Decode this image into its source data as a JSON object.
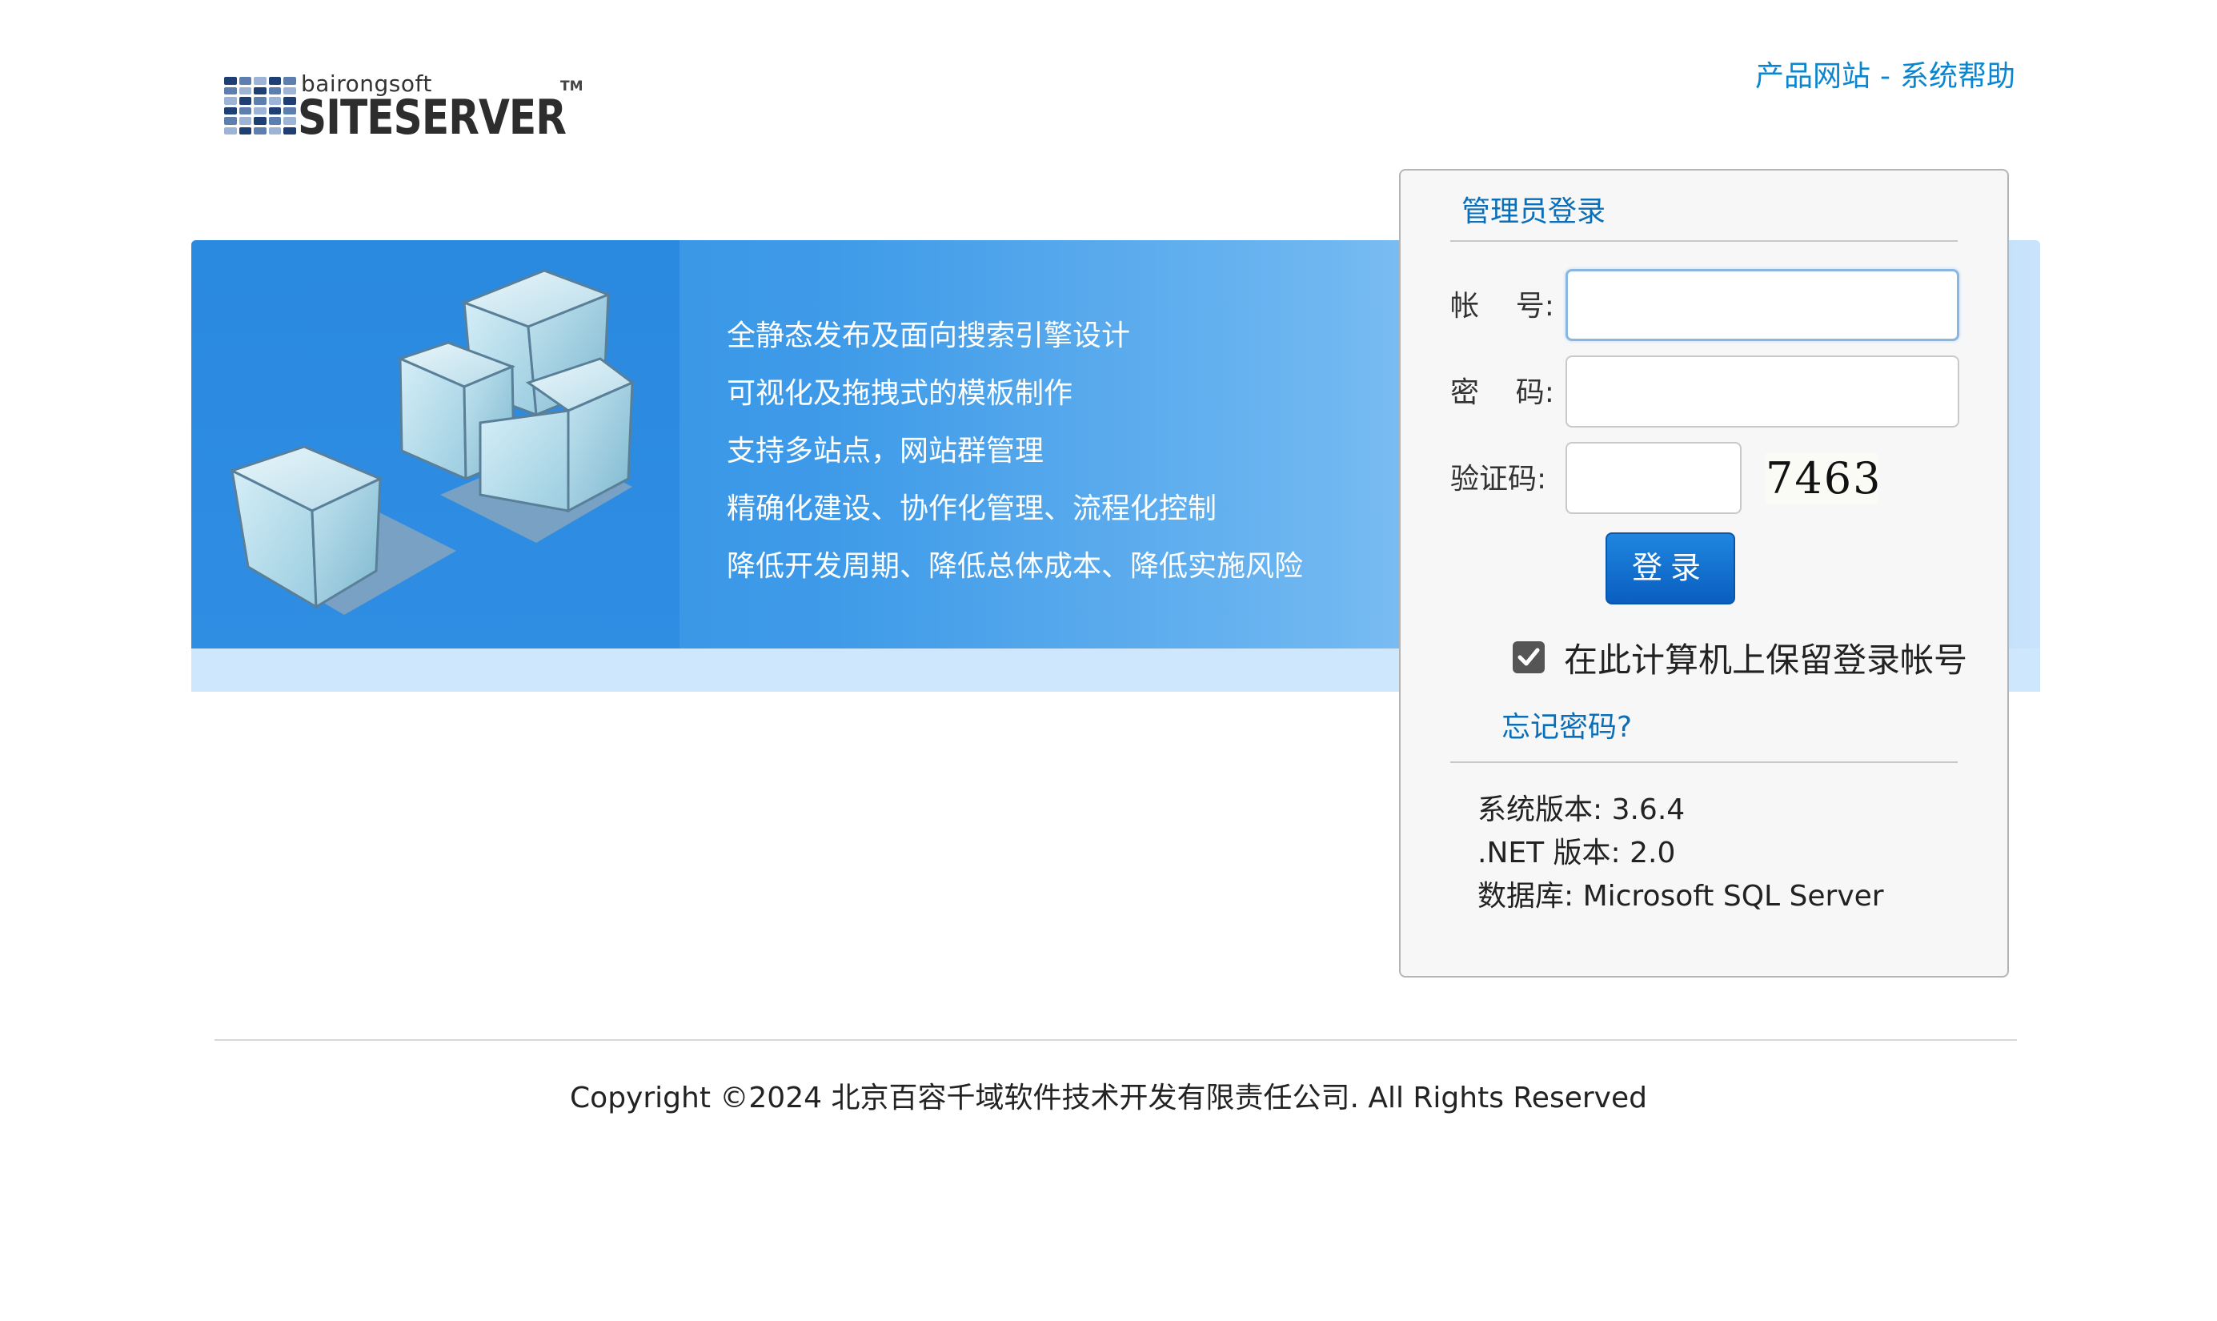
{
  "logo": {
    "subtitle": "bairongsoft",
    "name": "SITESERVER",
    "trademark": "TM",
    "grid_colors": [
      "#1d3f73",
      "#5d7fb0",
      "#9db4d6"
    ]
  },
  "top_links": {
    "product_site": "产品网站",
    "separator": "-",
    "help": "系统帮助"
  },
  "banner": {
    "features": [
      "全静态发布及面向搜索引擎设计",
      "可视化及拖拽式的模板制作",
      "支持多站点，网站群管理",
      "精确化建设、协作化管理、流程化控制",
      "降低开发周期、降低总体成本、降低实施风险"
    ]
  },
  "login": {
    "title": "管理员登录",
    "account_label": "帐    号:",
    "account_value": "",
    "password_label": "密    码:",
    "password_value": "",
    "captcha_label": "验证码:",
    "captcha_value": "",
    "captcha_text": "7463",
    "submit_label": "登录",
    "remember_label": "在此计算机上保留登录帐号",
    "remember_checked": true,
    "forgot_link": "忘记密码?"
  },
  "info": {
    "version": "系统版本: 3.6.4",
    "dotnet": ".NET 版本: 2.0",
    "database": "数据库: Microsoft SQL Server"
  },
  "footer": {
    "copyright": "Copyright ©2024 北京百容千域软件技术开发有限责任公司. All Rights Reserved"
  },
  "colors": {
    "link": "#0a86d0",
    "banner_blue": "#2d8fe3",
    "button_blue": "#0a5ec0"
  }
}
